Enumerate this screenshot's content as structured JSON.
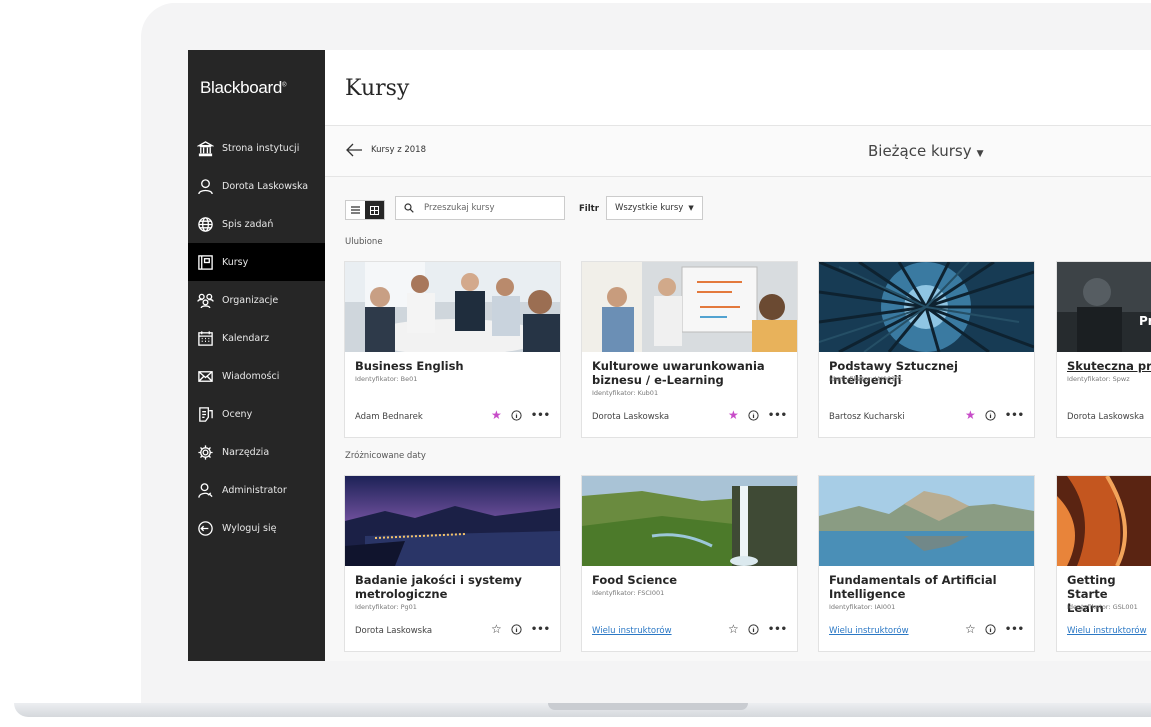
{
  "sidebar": {
    "logo": "Blackboard",
    "items": [
      {
        "label": "Strona instytucji",
        "icon": "institution-icon",
        "active": false
      },
      {
        "label": "Dorota Laskowska",
        "icon": "user-icon",
        "active": false
      },
      {
        "label": "Spis zadań",
        "icon": "globe-icon",
        "active": false
      },
      {
        "label": "Kursy",
        "icon": "courses-icon",
        "active": true
      },
      {
        "label": "Organizacje",
        "icon": "organizations-icon",
        "active": false
      },
      {
        "label": "Kalendarz",
        "icon": "calendar-icon",
        "active": false
      },
      {
        "label": "Wiadomości",
        "icon": "envelope-icon",
        "active": false
      },
      {
        "label": "Oceny",
        "icon": "grades-icon",
        "active": false
      },
      {
        "label": "Narzędzia",
        "icon": "tools-gear-icon",
        "active": false
      },
      {
        "label": "Administrator",
        "icon": "admin-icon",
        "active": false
      },
      {
        "label": "Wyloguj się",
        "icon": "logout-icon",
        "active": false
      }
    ]
  },
  "header": {
    "title": "Kursy"
  },
  "subbar": {
    "back_label": "Kursy z 2018",
    "current_label": "Bieżące kursy"
  },
  "toolbar": {
    "search_placeholder": "Przeszukaj kursy",
    "filter_label": "Filtr",
    "filter_value": "Wszystkie kursy"
  },
  "sections": {
    "favorites": "Ulubione",
    "varied_dates": "Zróżnicowane daty"
  },
  "favorites": [
    {
      "title": "Business English",
      "id": "Identyfikator: Be01",
      "instructor": "Adam Bednarek",
      "favorite": true
    },
    {
      "title": "Kulturowe uwarunkowania biznesu / e-Learning",
      "id": "Identyfikator: Kub01",
      "instructor": "Dorota Laskowska",
      "favorite": true
    },
    {
      "title": "Podstawy Sztucznej Inteligencji",
      "id": "Identyfikator: IAI001PL",
      "instructor": "Bartosz Kucharski",
      "favorite": true
    },
    {
      "title": "Skuteczna pra",
      "id": "Identyfikator: Spwz",
      "instructor": "Dorota Laskowska",
      "favorite": true,
      "image_text": "Pr"
    }
  ],
  "varied": [
    {
      "title": "Badanie jakości i systemy metrologiczne",
      "id": "Identyfikator: Pg01",
      "instructor": "Dorota Laskowska",
      "favorite": false
    },
    {
      "title": "Food Science",
      "id": "Identyfikator: FSCI001",
      "instructor": "Wielu instruktorów",
      "favorite": false
    },
    {
      "title": "Fundamentals of Artificial Intelligence",
      "id": "Identyfikator: IAI001",
      "instructor": "Wielu instruktorów",
      "favorite": false
    },
    {
      "title": "Getting Starte Learn",
      "id": "Identyfikator: GSL001",
      "instructor": "Wielu instruktorów",
      "favorite": false
    }
  ],
  "colors": {
    "sidebar_bg": "#262626",
    "favorite_star": "#c74cc8",
    "link": "#2b78c5"
  }
}
